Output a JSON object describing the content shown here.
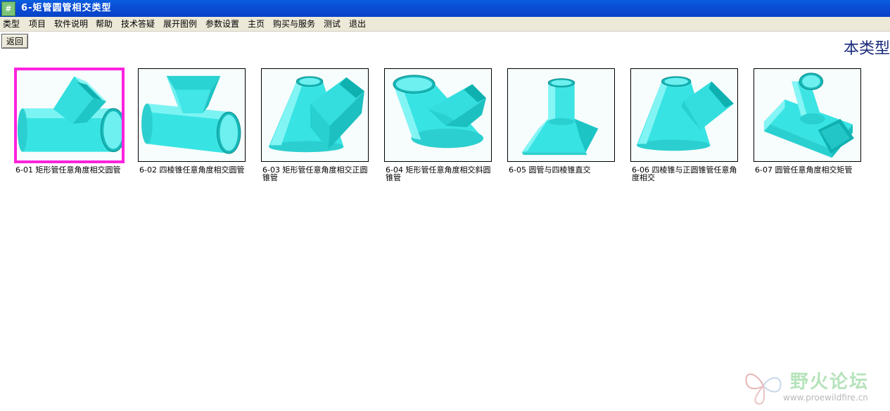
{
  "window": {
    "title": "6-矩管圆管相交类型",
    "icon_glyph": "#"
  },
  "menu": [
    "类型",
    "项目",
    "软件说明",
    "帮助",
    "技术答疑",
    "展开图例",
    "参数设置",
    "主页",
    "购买与服务",
    "测试",
    "退出"
  ],
  "toolbar": {
    "back_label": "返回"
  },
  "page": {
    "heading": "本类型"
  },
  "thumbnails": [
    {
      "caption": "6-01 矩形管任意角度相交圆管",
      "selected": true,
      "icon": "rectangular-pipe-cylinder-intersection-icon"
    },
    {
      "caption": "6-02 四棱锥任意角度相交圆管",
      "selected": false,
      "icon": "square-pyramid-cylinder-intersection-icon"
    },
    {
      "caption": "6-03 矩形管任意角度相交正圆锥管",
      "selected": false,
      "icon": "rectangular-pipe-cone-intersection-icon"
    },
    {
      "caption": "6-04 矩形管任意角度相交斜圆锥管",
      "selected": false,
      "icon": "rectangular-pipe-oblique-cone-intersection-icon"
    },
    {
      "caption": "6-05 圆管与四棱锥直交",
      "selected": false,
      "icon": "cylinder-pyramid-intersection-icon"
    },
    {
      "caption": "6-06 四棱锥与正圆锥管任意角度相交",
      "selected": false,
      "icon": "pyramid-cone-intersection-icon"
    },
    {
      "caption": "6-07 圆管任意角度相交矩管",
      "selected": false,
      "icon": "cylinder-rectangular-pipe-intersection-icon"
    }
  ],
  "watermark": {
    "text": "野火论坛",
    "url": "www.proewildfire.cn"
  },
  "colors": {
    "titlebar": "#0a4ed6",
    "selection": "#ff22dd",
    "model": "#33e6e6"
  }
}
